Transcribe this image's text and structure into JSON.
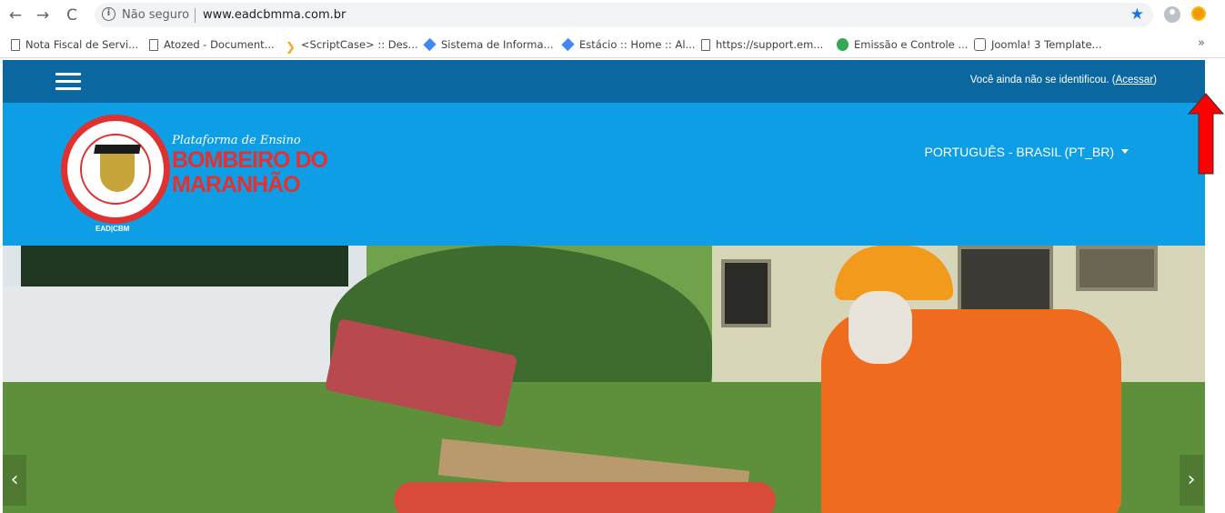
{
  "browser": {
    "security_label": "Não seguro",
    "url": "www.eadcbmma.com.br",
    "bookmarks": [
      {
        "label": "Nota Fiscal de Servi...",
        "icon": "page-icon"
      },
      {
        "label": "Atozed - Document...",
        "icon": "page-icon"
      },
      {
        "label": "<ScriptCase> :: Des...",
        "icon": "scriptcase-icon"
      },
      {
        "label": "Sistema de Informa...",
        "icon": "diamond-icon"
      },
      {
        "label": "Estácio :: Home :: Al...",
        "icon": "diamond-icon"
      },
      {
        "label": "https://support.em...",
        "icon": "page-icon"
      },
      {
        "label": "Emissão e Controle ...",
        "icon": "recycle-icon"
      },
      {
        "label": "Joomla! 3 Template...",
        "icon": "joomla-icon"
      }
    ],
    "more_label": "»",
    "colors": {
      "star": "#1a73e8"
    }
  },
  "site": {
    "topbar": {
      "login_prefix": "Você ainda não se identificou. (",
      "login_link": "Acessar",
      "login_suffix": ")"
    },
    "header": {
      "logo_script": "Plataforma de Ensino",
      "logo_title_line1": "BOMBEIRO DO",
      "logo_title_line2": "MARANHÃO",
      "logo_caption": "EAD|CBM",
      "language": "PORTUGUÊS - BRASIL (PT_BR)"
    },
    "slider": {
      "prev": "‹",
      "next": "›"
    },
    "colors": {
      "topbar": "#0b67a0",
      "header": "#0d9ee6",
      "logo_red": "#e53030",
      "annotation_arrow": "#ff0000"
    }
  }
}
